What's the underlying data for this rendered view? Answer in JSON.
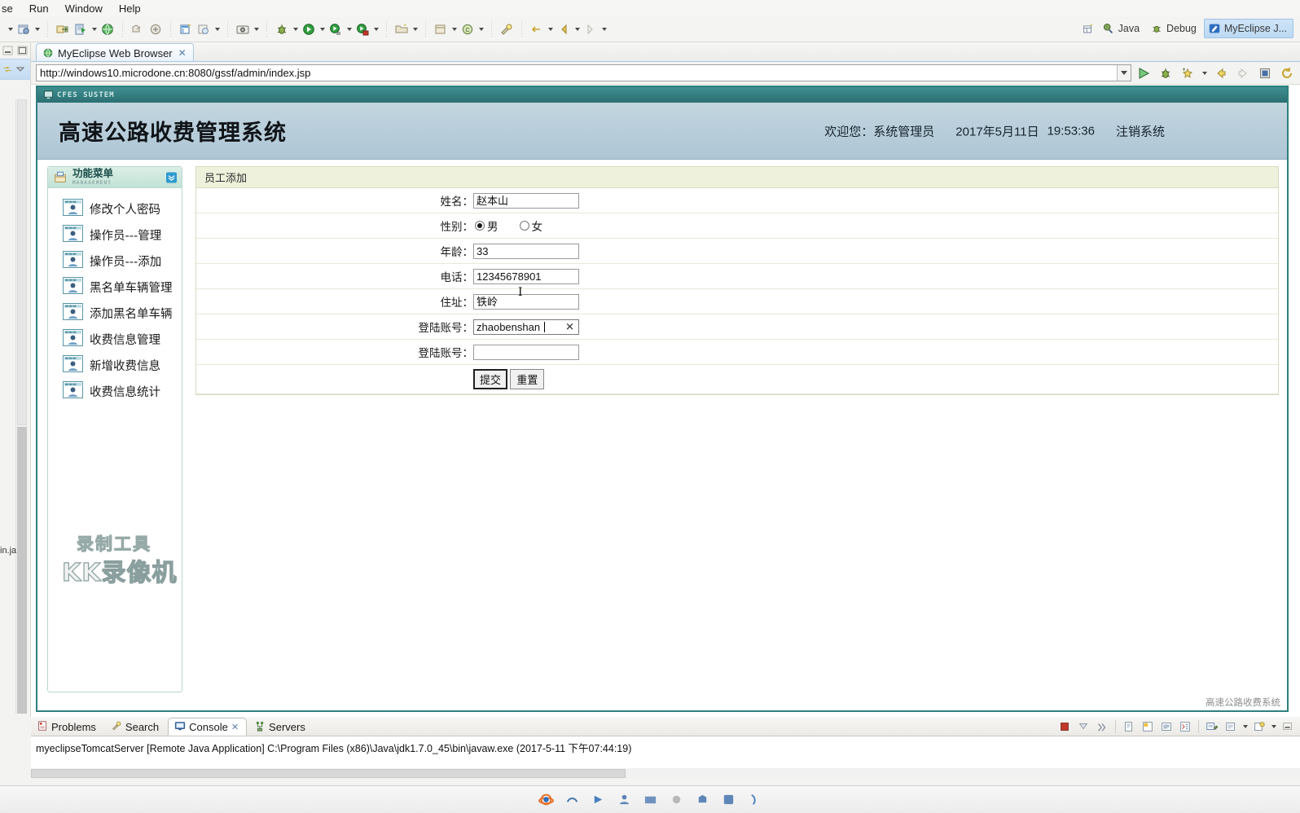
{
  "ide": {
    "menus": [
      "se",
      "Run",
      "Window",
      "Help"
    ],
    "perspectives": {
      "java": "Java",
      "debug": "Debug",
      "myeclipse": "MyEclipse J..."
    },
    "editor_tab": {
      "title": "MyEclipse Web Browser",
      "close": "✕"
    },
    "url": "http://windows10.microdone.cn:8080/gssf/admin/index.jsp",
    "bottom_tabs": [
      {
        "label": "Problems",
        "icon": "problems-icon",
        "active": false,
        "closable": false
      },
      {
        "label": "Search",
        "icon": "search-icon",
        "active": false,
        "closable": false
      },
      {
        "label": "Console",
        "icon": "console-icon",
        "active": true,
        "closable": true
      },
      {
        "label": "Servers",
        "icon": "servers-icon",
        "active": false,
        "closable": false
      }
    ],
    "console_line": "myeclipseTomcatServer [Remote Java Application] C:\\Program Files (x86)\\Java\\jdk1.7.0_45\\bin\\javaw.exe (2017-5-11 下午07:44:19)",
    "rail_label": "in.ja"
  },
  "site": {
    "titlebar": "CFES SUSTEM",
    "title": "高速公路收费管理系统",
    "welcome_label": "欢迎您：",
    "welcome_user": "系统管理员",
    "date": "2017年5月11日",
    "time": "19:53:36",
    "logout": "注销系统",
    "footer": "高速公路收费系统",
    "colors": {
      "header_top": "#c3d6e0",
      "border": "#2f7f7f",
      "titlebar": "#37807f",
      "panel_caption_bg": "#eef2dc"
    }
  },
  "sidebar": {
    "title_cn": "功能菜单",
    "title_en": "MANAGEMENT",
    "items": [
      {
        "label": "修改个人密码"
      },
      {
        "label": "操作员---管理"
      },
      {
        "label": "操作员---添加"
      },
      {
        "label": "黑名单车辆管理"
      },
      {
        "label": "添加黑名单车辆"
      },
      {
        "label": "收费信息管理"
      },
      {
        "label": "新增收费信息"
      },
      {
        "label": "收费信息统计"
      }
    ]
  },
  "form": {
    "caption": "员工添加",
    "rows": [
      {
        "label": "姓名：",
        "type": "text",
        "value": "赵本山",
        "name": "name-field"
      },
      {
        "label": "性别：",
        "type": "radio",
        "name": "gender-field"
      },
      {
        "label": "年龄：",
        "type": "text",
        "value": "33",
        "name": "age-field"
      },
      {
        "label": "电话：",
        "type": "text",
        "value": "12345678901",
        "name": "phone-field"
      },
      {
        "label": "住址：",
        "type": "text",
        "value": "铁岭",
        "name": "address-field"
      },
      {
        "label": "登陆账号：",
        "type": "text",
        "value": "zhaobenshan",
        "name": "account-field"
      },
      {
        "label": "登陆账号：",
        "type": "text",
        "value": "",
        "name": "password-field"
      }
    ],
    "gender": {
      "male": "男",
      "female": "女",
      "selected": "男"
    },
    "submit": "提交",
    "reset": "重置",
    "autofill_clear": "✕"
  },
  "watermark": {
    "line1": "录制工具",
    "line2": "KK录像机"
  }
}
